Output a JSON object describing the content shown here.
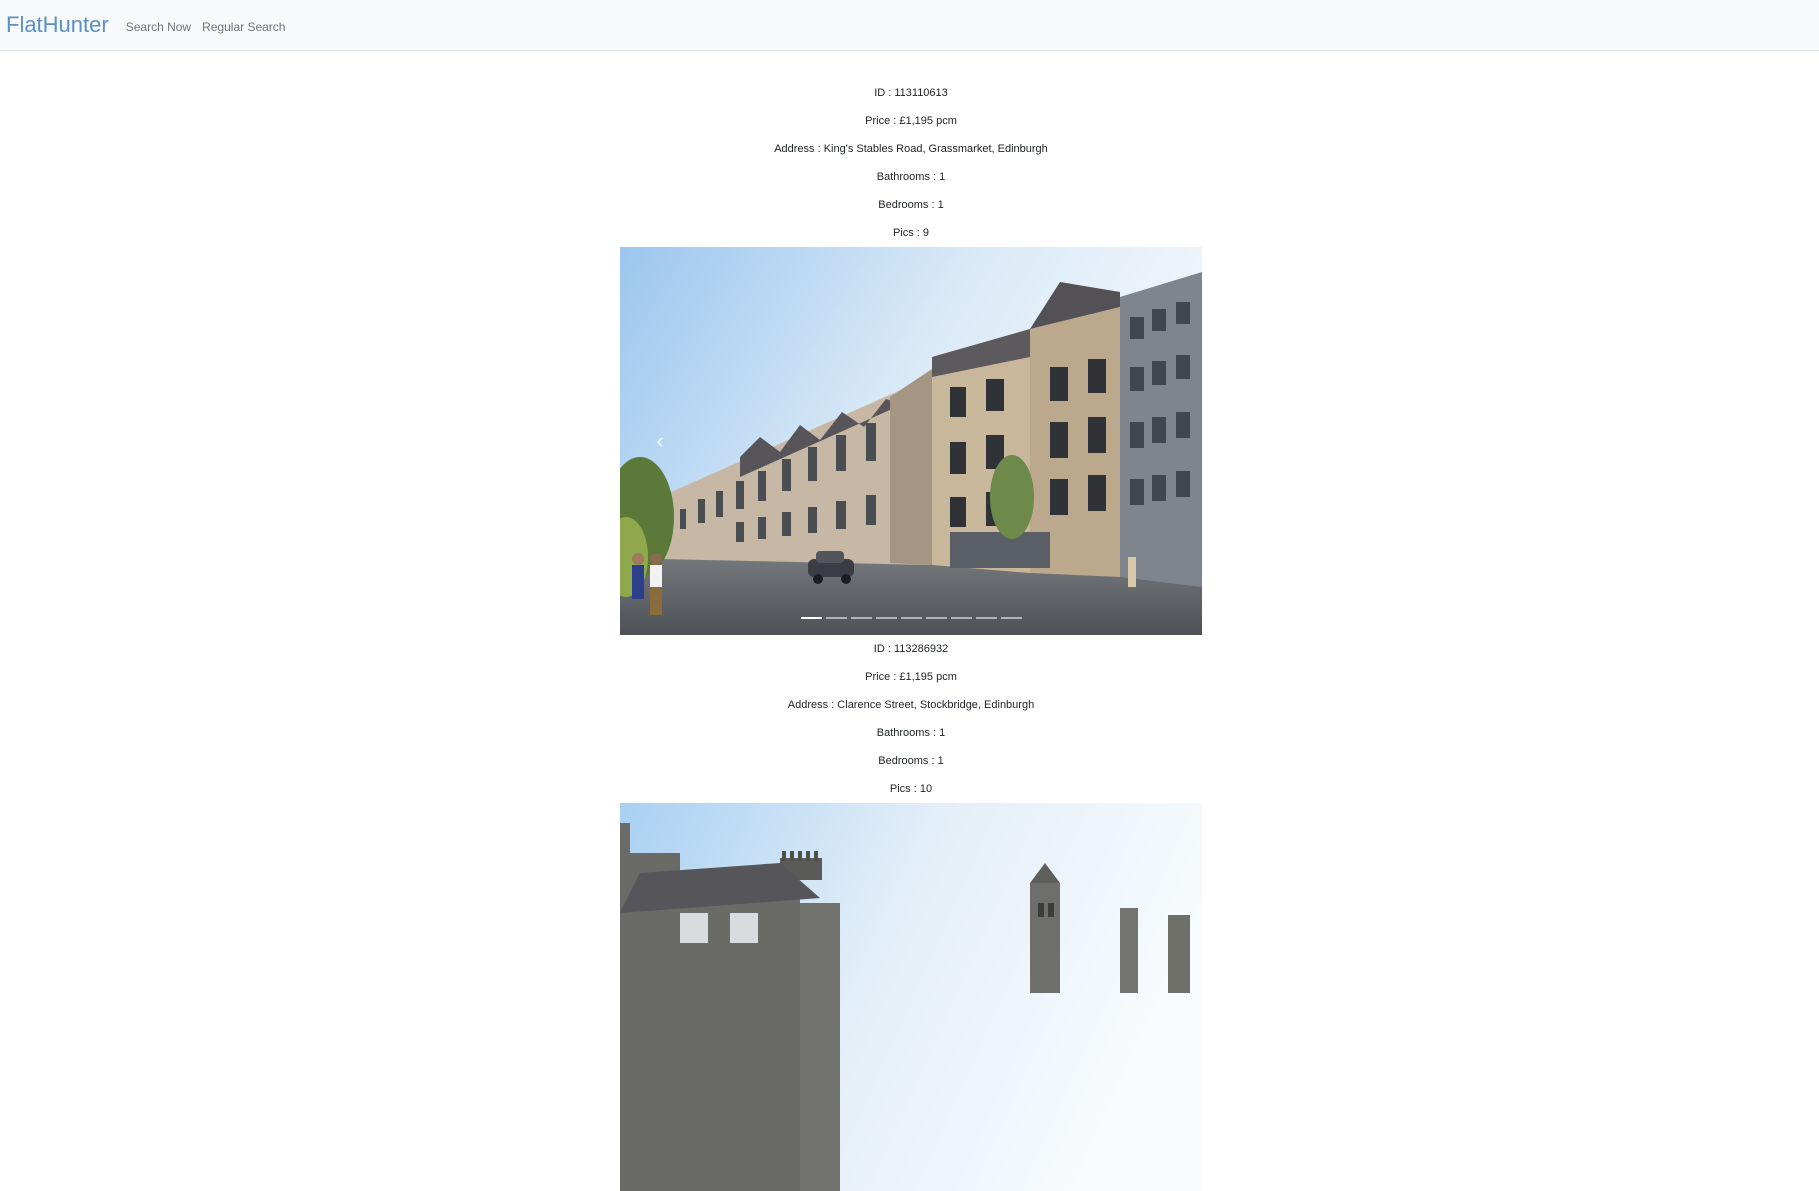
{
  "nav": {
    "brand": "FlatHunter",
    "links": [
      "Search Now",
      "Regular Search"
    ]
  },
  "listings": [
    {
      "id": "ID : 113110613",
      "price": "Price : £1,195 pcm",
      "address": "Address : King's Stables Road, Grassmarket, Edinburgh",
      "bathrooms": "Bathrooms : 1",
      "bedrooms": "Bedrooms : 1",
      "pics": "Pics : 9",
      "indicator_count": 9,
      "active_indicator": 1
    },
    {
      "id": "ID : 113286932",
      "price": "Price : £1,195 pcm",
      "address": "Address : Clarence Street, Stockbridge, Edinburgh",
      "bathrooms": "Bathrooms : 1",
      "bedrooms": "Bedrooms : 1",
      "pics": "Pics : 10"
    }
  ],
  "icons": {
    "prev": "chevron-left-icon"
  },
  "colors": {
    "brand": "#5a8fc8",
    "navbar_bg": "#f8f9fa"
  }
}
